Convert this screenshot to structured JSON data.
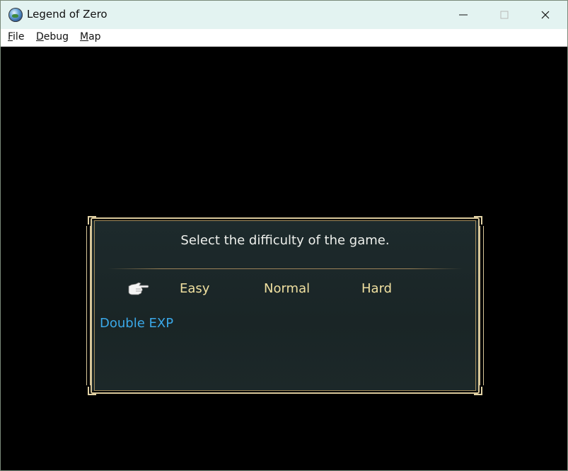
{
  "window": {
    "title": "Legend of Zero",
    "icon": "globe-icon"
  },
  "menu": {
    "items": [
      {
        "label": "File",
        "mnemonic": "F",
        "rest": "ile"
      },
      {
        "label": "Debug",
        "mnemonic": "D",
        "rest": "ebug"
      },
      {
        "label": "Map",
        "mnemonic": "M",
        "rest": "ap"
      }
    ]
  },
  "dialog": {
    "prompt": "Select the difficulty of the game.",
    "options": [
      "Easy",
      "Normal",
      "Hard"
    ],
    "selected_index": 0,
    "cursor_icon": "pointing-hand-icon",
    "extra_option": "Double EXP",
    "colors": {
      "option": "#f0e0a0",
      "extra": "#3aa8e8",
      "frame": "#d8c79a",
      "background": "#1b2628"
    }
  }
}
